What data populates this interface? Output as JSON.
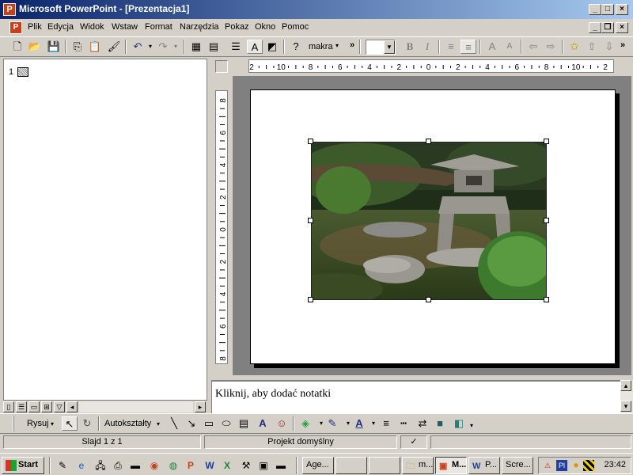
{
  "window": {
    "title": "Microsoft PowerPoint - [Prezentacja1]"
  },
  "menu": {
    "items": [
      "Plik",
      "Edycja",
      "Widok",
      "Wstaw",
      "Format",
      "Narzędzia",
      "Pokaz",
      "Okno",
      "Pomoc"
    ]
  },
  "toolbar": {
    "macro_combo": "makra",
    "font_size": ""
  },
  "outline": {
    "slide_number": "1"
  },
  "rulers": {
    "horizontal_labels": [
      "2",
      "10",
      "8",
      "6",
      "4",
      "2",
      "0",
      "2",
      "4",
      "6",
      "8",
      "10",
      "2"
    ],
    "vertical_labels": [
      "8",
      "6",
      "4",
      "2",
      "0",
      "2",
      "4",
      "6",
      "8"
    ]
  },
  "notes": {
    "placeholder": "Kliknij, aby dodać notatki"
  },
  "drawbar": {
    "draw_label": "Rysuj",
    "autoshapes_label": "Autokształty"
  },
  "status": {
    "slide": "Slajd 1 z 1",
    "design": "Projekt domyślny"
  },
  "taskbar": {
    "start_label": "Start",
    "tasks": [
      "Age...",
      "",
      "",
      "m...",
      "M...",
      "P...",
      "Scre..."
    ],
    "lang": "Pl",
    "clock": "23:42"
  }
}
